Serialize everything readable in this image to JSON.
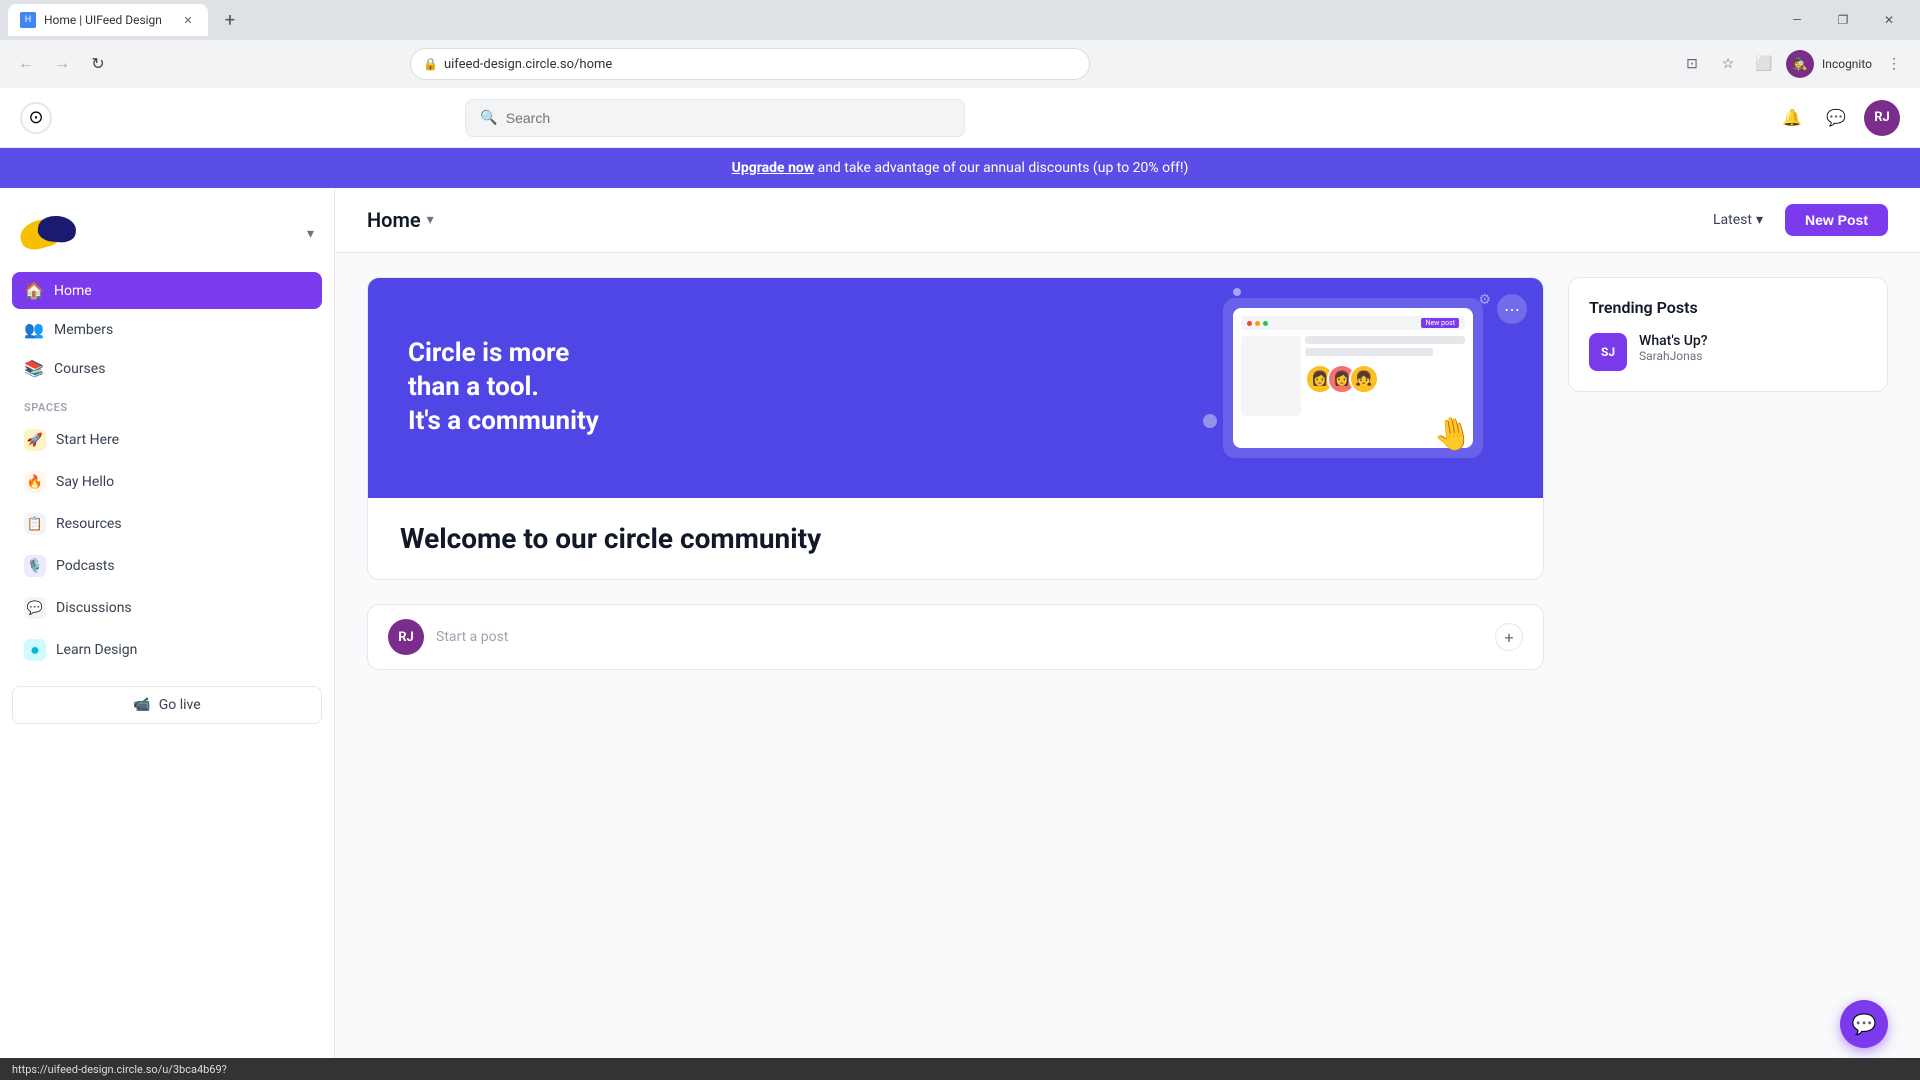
{
  "browser": {
    "tab_title": "Home | UIFeed Design",
    "tab_favicon": "H",
    "url": "uifeed-design.circle.so/home",
    "profile_label": "Incognito",
    "profile_initials": "RJ"
  },
  "promo_banner": {
    "link_text": "Upgrade now",
    "text": " and take advantage of our annual discounts (up to 20% off!)"
  },
  "header": {
    "search_placeholder": "Search",
    "user_initials": "RJ"
  },
  "sidebar": {
    "nav_items": [
      {
        "label": "Home",
        "icon": "🏠",
        "active": true
      },
      {
        "label": "Members",
        "icon": "👥",
        "active": false
      },
      {
        "label": "Courses",
        "icon": "📚",
        "active": false
      }
    ],
    "spaces_label": "Spaces",
    "spaces": [
      {
        "label": "Start Here",
        "icon": "🚀",
        "color": "#f59e0b"
      },
      {
        "label": "Say Hello",
        "icon": "🔥",
        "color": "#f97316"
      },
      {
        "label": "Resources",
        "icon": "📋",
        "color": "#6b7280"
      },
      {
        "label": "Podcasts",
        "icon": "🎙️",
        "color": "#8b5cf6"
      },
      {
        "label": "Discussions",
        "icon": "💬",
        "color": "#6b7280"
      },
      {
        "label": "Learn Design",
        "icon": "●",
        "color": "#06b6d4"
      }
    ],
    "go_live_label": "Go live"
  },
  "content": {
    "page_title": "Home",
    "sort_label": "Latest",
    "new_post_label": "New Post"
  },
  "welcome_card": {
    "banner_line1": "Circle is more",
    "banner_line2": "than a tool.",
    "banner_line3": "It's a community",
    "body_title": "Welcome to our circle community"
  },
  "start_post": {
    "user_initials": "RJ",
    "placeholder": "Start a post"
  },
  "trending": {
    "title": "Trending Posts",
    "items": [
      {
        "initials": "SJ",
        "color": "#7c3aed",
        "post_title": "What's Up?",
        "author": "SarahJonas"
      }
    ]
  },
  "chat_fab": "💬",
  "status_bar": {
    "url": "https://uifeed-design.circle.so/u/3bca4b69?"
  }
}
